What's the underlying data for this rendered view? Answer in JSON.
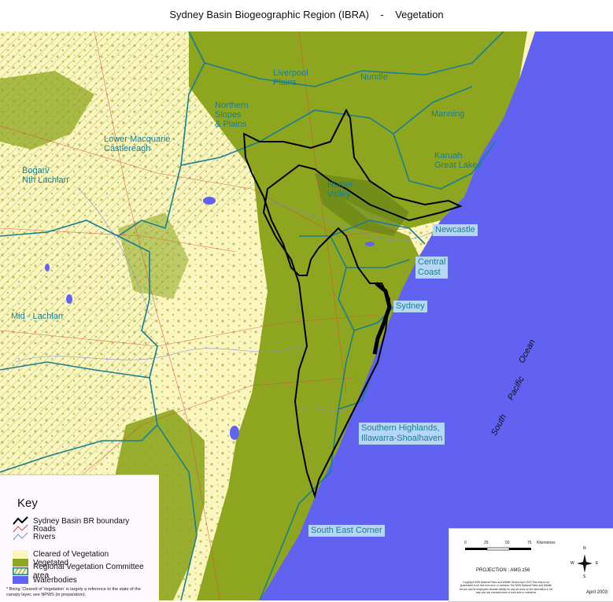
{
  "title": {
    "text": "Sydney Basin Biogeographic Region (IBRA)    -    Vegetation"
  },
  "colors": {
    "cleared": "#fbf5c0",
    "vegetated": "#8ea51f",
    "vegetated_dark": "#6f8a18",
    "waterbodies": "#6262f2",
    "rvc_boundary": "#1a7f8e",
    "ibra_boundary": "#000000",
    "roads": "#d94a3a",
    "rivers": "#7f8bd9",
    "label": "#1a7f8e",
    "coastal_label_bg": "#b6d6f5"
  },
  "regions": [
    {
      "name": "Liverpool\nPlains"
    },
    {
      "name": "Nundle"
    },
    {
      "name": "Northern\nSlopes\n& Plains"
    },
    {
      "name": "Manning"
    },
    {
      "name": "Lower Macquarie -\nCastlereagh"
    },
    {
      "name": "Karuah\nGreat Lakes"
    },
    {
      "name": "Bogan/\nNth Lachlan"
    },
    {
      "name": "Hunter\nValley"
    },
    {
      "name": "Mid - Lachlan"
    }
  ],
  "coastal_labels": [
    {
      "name": "Newcastle"
    },
    {
      "name": "Central\nCoast"
    },
    {
      "name": "Sydney"
    },
    {
      "name": "Southern Highlands,\nIllawarra-Shoalhaven"
    },
    {
      "name": "South East Corner"
    }
  ],
  "ocean_label": {
    "words": [
      "South",
      "Pacific",
      "Ocean"
    ]
  },
  "legend": {
    "title": "Key",
    "items": [
      {
        "label": "Sydney Basin BR boundary",
        "type": "line",
        "color": "#000000"
      },
      {
        "label": "Roads",
        "type": "line",
        "color": "#d94a3a"
      },
      {
        "label": "Rivers",
        "type": "line",
        "color": "#7f8bd9"
      },
      {
        "label": "Cleared of Vegetation",
        "type": "fill",
        "color": "#fbf5c0"
      },
      {
        "label": "Vegetated",
        "type": "fill",
        "color": "#8ea51f"
      },
      {
        "label": "Regional Vegetation Committee area",
        "type": "hatch",
        "color": "#1a7f8e"
      },
      {
        "label": "Waterbodies",
        "type": "fill",
        "color": "#6262f2"
      }
    ],
    "footnote": "*   Being 'Cleared of Vegetation' is largely a reference to the state of the canopy layer, see NPWS (in preparation)."
  },
  "scale_bar": {
    "ticks": [
      "0",
      "25",
      "50",
      "75"
    ],
    "unit": "Kilometres"
  },
  "projection": "PROJECTION :     AMG z56",
  "copyright": "Copyright NSW National Parks and Wildlife Service April 2003 This map is not guaranteed to be free from error or omission The NSW National Parks and Wildlife Service and its employees disclaim liability for any act done on the information in the map and any consequences of such acts or omissions",
  "compass": {
    "N": "N",
    "S": "S",
    "E": "E",
    "W": "W"
  },
  "date": "April 2003"
}
